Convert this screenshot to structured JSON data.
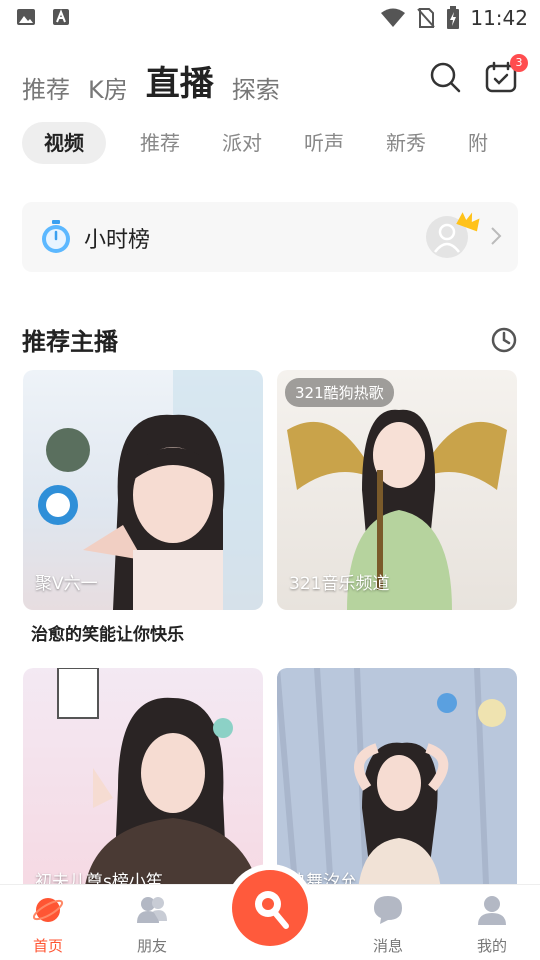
{
  "status_bar": {
    "time": "11:42"
  },
  "top_tabs": [
    {
      "label": "推荐",
      "active": false
    },
    {
      "label": "K房",
      "active": false
    },
    {
      "label": "直播",
      "active": true
    },
    {
      "label": "探索",
      "active": false
    }
  ],
  "notification_badge": "3",
  "sub_tabs": [
    {
      "label": "视频",
      "active": true
    },
    {
      "label": "推荐",
      "active": false
    },
    {
      "label": "派对",
      "active": false
    },
    {
      "label": "听声",
      "active": false
    },
    {
      "label": "新秀",
      "active": false
    },
    {
      "label": "附",
      "active": false
    }
  ],
  "hourly": {
    "label": "小时榜"
  },
  "section": {
    "title": "推荐主播"
  },
  "cards": [
    {
      "tag": "",
      "overlay": "聚V六一",
      "caption": "治愈的笑能让你快乐"
    },
    {
      "tag": "321酷狗热歌",
      "overlay": "321音乐频道",
      "caption": ""
    },
    {
      "tag": "",
      "overlay": "初夫儿尊s榜小笙",
      "caption": ""
    },
    {
      "tag": "",
      "overlay": "热舞汐允",
      "caption": ""
    }
  ],
  "bottom_nav": [
    {
      "label": "首页",
      "active": true
    },
    {
      "label": "朋友",
      "active": false
    },
    {
      "label": "消息",
      "active": false
    },
    {
      "label": "我的",
      "active": false
    }
  ],
  "colors": {
    "accent": "#ff5a3c",
    "active_nav": "#ff5533"
  }
}
